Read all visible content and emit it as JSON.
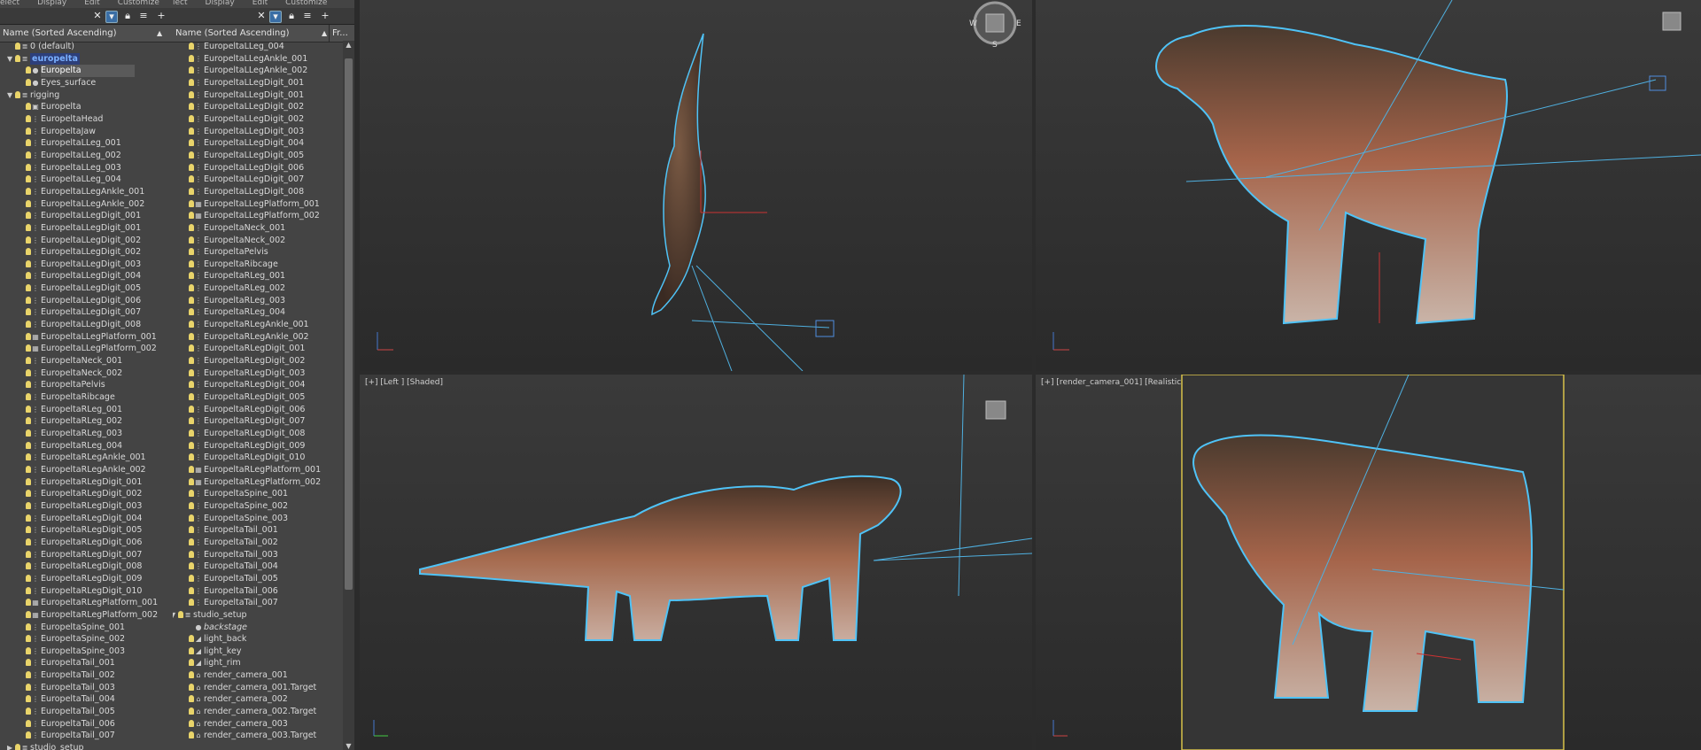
{
  "panel1": {
    "menu": [
      "elect",
      "Display",
      "Edit",
      "Customize"
    ],
    "col_name": "Name (Sorted Ascending)",
    "rows": [
      {
        "label": "0 (default)",
        "indent": 34,
        "bulb": true,
        "icon": "layer-icon"
      },
      {
        "label": "europelta",
        "indent": 34,
        "bulb": true,
        "icon": "layer-icon",
        "tri": "▼",
        "hi": true
      },
      {
        "label": "Europelta",
        "indent": 46,
        "bulb": true,
        "icon": "sphere-icon",
        "sel": true
      },
      {
        "label": "Eyes_surface",
        "indent": 46,
        "bulb": true,
        "icon": "sphere-icon"
      },
      {
        "label": "rigging",
        "indent": 34,
        "bulb": true,
        "icon": "layer-icon",
        "tri": "▼"
      },
      {
        "label": "Europelta",
        "indent": 46,
        "bulb": true,
        "icon": "group-icon"
      },
      {
        "label": "EuropeltaHead",
        "indent": 46,
        "bulb": true,
        "icon": "bone-icon"
      },
      {
        "label": "EuropeltaJaw",
        "indent": 46,
        "bulb": true,
        "icon": "bone-icon"
      },
      {
        "label": "EuropeltaLLeg_001",
        "indent": 46,
        "bulb": true,
        "icon": "bone-icon"
      },
      {
        "label": "EuropeltaLLeg_002",
        "indent": 46,
        "bulb": true,
        "icon": "bone-icon"
      },
      {
        "label": "EuropeltaLLeg_003",
        "indent": 46,
        "bulb": true,
        "icon": "bone-icon"
      },
      {
        "label": "EuropeltaLLeg_004",
        "indent": 46,
        "bulb": true,
        "icon": "bone-icon"
      },
      {
        "label": "EuropeltaLLegAnkle_001",
        "indent": 46,
        "bulb": true,
        "icon": "bone-icon"
      },
      {
        "label": "EuropeltaLLegAnkle_002",
        "indent": 46,
        "bulb": true,
        "icon": "bone-icon"
      },
      {
        "label": "EuropeltaLLegDigit_001",
        "indent": 46,
        "bulb": true,
        "icon": "bone-icon"
      },
      {
        "label": "EuropeltaLLegDigit_001",
        "indent": 46,
        "bulb": true,
        "icon": "bone-icon"
      },
      {
        "label": "EuropeltaLLegDigit_002",
        "indent": 46,
        "bulb": true,
        "icon": "bone-icon"
      },
      {
        "label": "EuropeltaLLegDigit_002",
        "indent": 46,
        "bulb": true,
        "icon": "bone-icon"
      },
      {
        "label": "EuropeltaLLegDigit_003",
        "indent": 46,
        "bulb": true,
        "icon": "bone-icon"
      },
      {
        "label": "EuropeltaLLegDigit_004",
        "indent": 46,
        "bulb": true,
        "icon": "bone-icon"
      },
      {
        "label": "EuropeltaLLegDigit_005",
        "indent": 46,
        "bulb": true,
        "icon": "bone-icon"
      },
      {
        "label": "EuropeltaLLegDigit_006",
        "indent": 46,
        "bulb": true,
        "icon": "bone-icon"
      },
      {
        "label": "EuropeltaLLegDigit_007",
        "indent": 46,
        "bulb": true,
        "icon": "bone-icon"
      },
      {
        "label": "EuropeltaLLegDigit_008",
        "indent": 46,
        "bulb": true,
        "icon": "bone-icon"
      },
      {
        "label": "EuropeltaLLegPlatform_001",
        "indent": 46,
        "bulb": true,
        "icon": "platform-icon"
      },
      {
        "label": "EuropeltaLLegPlatform_002",
        "indent": 46,
        "bulb": true,
        "icon": "platform-icon"
      },
      {
        "label": "EuropeltaNeck_001",
        "indent": 46,
        "bulb": true,
        "icon": "bone-icon"
      },
      {
        "label": "EuropeltaNeck_002",
        "indent": 46,
        "bulb": true,
        "icon": "bone-icon"
      },
      {
        "label": "EuropeltaPelvis",
        "indent": 46,
        "bulb": true,
        "icon": "bone-icon"
      },
      {
        "label": "EuropeltaRibcage",
        "indent": 46,
        "bulb": true,
        "icon": "bone-icon"
      },
      {
        "label": "EuropeltaRLeg_001",
        "indent": 46,
        "bulb": true,
        "icon": "bone-icon"
      },
      {
        "label": "EuropeltaRLeg_002",
        "indent": 46,
        "bulb": true,
        "icon": "bone-icon"
      },
      {
        "label": "EuropeltaRLeg_003",
        "indent": 46,
        "bulb": true,
        "icon": "bone-icon"
      },
      {
        "label": "EuropeltaRLeg_004",
        "indent": 46,
        "bulb": true,
        "icon": "bone-icon"
      },
      {
        "label": "EuropeltaRLegAnkle_001",
        "indent": 46,
        "bulb": true,
        "icon": "bone-icon"
      },
      {
        "label": "EuropeltaRLegAnkle_002",
        "indent": 46,
        "bulb": true,
        "icon": "bone-icon"
      },
      {
        "label": "EuropeltaRLegDigit_001",
        "indent": 46,
        "bulb": true,
        "icon": "bone-icon"
      },
      {
        "label": "EuropeltaRLegDigit_002",
        "indent": 46,
        "bulb": true,
        "icon": "bone-icon"
      },
      {
        "label": "EuropeltaRLegDigit_003",
        "indent": 46,
        "bulb": true,
        "icon": "bone-icon"
      },
      {
        "label": "EuropeltaRLegDigit_004",
        "indent": 46,
        "bulb": true,
        "icon": "bone-icon"
      },
      {
        "label": "EuropeltaRLegDigit_005",
        "indent": 46,
        "bulb": true,
        "icon": "bone-icon"
      },
      {
        "label": "EuropeltaRLegDigit_006",
        "indent": 46,
        "bulb": true,
        "icon": "bone-icon"
      },
      {
        "label": "EuropeltaRLegDigit_007",
        "indent": 46,
        "bulb": true,
        "icon": "bone-icon"
      },
      {
        "label": "EuropeltaRLegDigit_008",
        "indent": 46,
        "bulb": true,
        "icon": "bone-icon"
      },
      {
        "label": "EuropeltaRLegDigit_009",
        "indent": 46,
        "bulb": true,
        "icon": "bone-icon"
      },
      {
        "label": "EuropeltaRLegDigit_010",
        "indent": 46,
        "bulb": true,
        "icon": "bone-icon"
      },
      {
        "label": "EuropeltaRLegPlatform_001",
        "indent": 46,
        "bulb": true,
        "icon": "platform-icon"
      },
      {
        "label": "EuropeltaRLegPlatform_002",
        "indent": 46,
        "bulb": true,
        "icon": "platform-icon"
      },
      {
        "label": "EuropeltaSpine_001",
        "indent": 46,
        "bulb": true,
        "icon": "bone-icon"
      },
      {
        "label": "EuropeltaSpine_002",
        "indent": 46,
        "bulb": true,
        "icon": "bone-icon"
      },
      {
        "label": "EuropeltaSpine_003",
        "indent": 46,
        "bulb": true,
        "icon": "bone-icon"
      },
      {
        "label": "EuropeltaTail_001",
        "indent": 46,
        "bulb": true,
        "icon": "bone-icon"
      },
      {
        "label": "EuropeltaTail_002",
        "indent": 46,
        "bulb": true,
        "icon": "bone-icon"
      },
      {
        "label": "EuropeltaTail_003",
        "indent": 46,
        "bulb": true,
        "icon": "bone-icon"
      },
      {
        "label": "EuropeltaTail_004",
        "indent": 46,
        "bulb": true,
        "icon": "bone-icon"
      },
      {
        "label": "EuropeltaTail_005",
        "indent": 46,
        "bulb": true,
        "icon": "bone-icon"
      },
      {
        "label": "EuropeltaTail_006",
        "indent": 46,
        "bulb": true,
        "icon": "bone-icon"
      },
      {
        "label": "EuropeltaTail_007",
        "indent": 46,
        "bulb": true,
        "icon": "bone-icon"
      },
      {
        "label": "studio_setup",
        "indent": 34,
        "bulb": true,
        "icon": "layer-icon",
        "tri": "▶"
      }
    ]
  },
  "panel2": {
    "menu": [
      "lect",
      "Display",
      "Edit",
      "Customize"
    ],
    "col_name": "Name (Sorted Ascending)",
    "col_fr": "Fr...",
    "rows": [
      {
        "label": "EuropeltaLLeg_004",
        "indent": 35,
        "bulb": true,
        "icon": "bone-icon"
      },
      {
        "label": "EuropeltaLLegAnkle_001",
        "indent": 35,
        "bulb": true,
        "icon": "bone-icon"
      },
      {
        "label": "EuropeltaLLegAnkle_002",
        "indent": 35,
        "bulb": true,
        "icon": "bone-icon"
      },
      {
        "label": "EuropeltaLLegDigit_001",
        "indent": 35,
        "bulb": true,
        "icon": "bone-icon"
      },
      {
        "label": "EuropeltaLLegDigit_001",
        "indent": 35,
        "bulb": true,
        "icon": "bone-icon"
      },
      {
        "label": "EuropeltaLLegDigit_002",
        "indent": 35,
        "bulb": true,
        "icon": "bone-icon"
      },
      {
        "label": "EuropeltaLLegDigit_002",
        "indent": 35,
        "bulb": true,
        "icon": "bone-icon"
      },
      {
        "label": "EuropeltaLLegDigit_003",
        "indent": 35,
        "bulb": true,
        "icon": "bone-icon"
      },
      {
        "label": "EuropeltaLLegDigit_004",
        "indent": 35,
        "bulb": true,
        "icon": "bone-icon"
      },
      {
        "label": "EuropeltaLLegDigit_005",
        "indent": 35,
        "bulb": true,
        "icon": "bone-icon"
      },
      {
        "label": "EuropeltaLLegDigit_006",
        "indent": 35,
        "bulb": true,
        "icon": "bone-icon"
      },
      {
        "label": "EuropeltaLLegDigit_007",
        "indent": 35,
        "bulb": true,
        "icon": "bone-icon"
      },
      {
        "label": "EuropeltaLLegDigit_008",
        "indent": 35,
        "bulb": true,
        "icon": "bone-icon"
      },
      {
        "label": "EuropeltaLLegPlatform_001",
        "indent": 35,
        "bulb": true,
        "icon": "platform-icon"
      },
      {
        "label": "EuropeltaLLegPlatform_002",
        "indent": 35,
        "bulb": true,
        "icon": "platform-icon"
      },
      {
        "label": "EuropeltaNeck_001",
        "indent": 35,
        "bulb": true,
        "icon": "bone-icon"
      },
      {
        "label": "EuropeltaNeck_002",
        "indent": 35,
        "bulb": true,
        "icon": "bone-icon"
      },
      {
        "label": "EuropeltaPelvis",
        "indent": 35,
        "bulb": true,
        "icon": "bone-icon"
      },
      {
        "label": "EuropeltaRibcage",
        "indent": 35,
        "bulb": true,
        "icon": "bone-icon"
      },
      {
        "label": "EuropeltaRLeg_001",
        "indent": 35,
        "bulb": true,
        "icon": "bone-icon"
      },
      {
        "label": "EuropeltaRLeg_002",
        "indent": 35,
        "bulb": true,
        "icon": "bone-icon"
      },
      {
        "label": "EuropeltaRLeg_003",
        "indent": 35,
        "bulb": true,
        "icon": "bone-icon"
      },
      {
        "label": "EuropeltaRLeg_004",
        "indent": 35,
        "bulb": true,
        "icon": "bone-icon"
      },
      {
        "label": "EuropeltaRLegAnkle_001",
        "indent": 35,
        "bulb": true,
        "icon": "bone-icon"
      },
      {
        "label": "EuropeltaRLegAnkle_002",
        "indent": 35,
        "bulb": true,
        "icon": "bone-icon"
      },
      {
        "label": "EuropeltaRLegDigit_001",
        "indent": 35,
        "bulb": true,
        "icon": "bone-icon"
      },
      {
        "label": "EuropeltaRLegDigit_002",
        "indent": 35,
        "bulb": true,
        "icon": "bone-icon"
      },
      {
        "label": "EuropeltaRLegDigit_003",
        "indent": 35,
        "bulb": true,
        "icon": "bone-icon"
      },
      {
        "label": "EuropeltaRLegDigit_004",
        "indent": 35,
        "bulb": true,
        "icon": "bone-icon"
      },
      {
        "label": "EuropeltaRLegDigit_005",
        "indent": 35,
        "bulb": true,
        "icon": "bone-icon"
      },
      {
        "label": "EuropeltaRLegDigit_006",
        "indent": 35,
        "bulb": true,
        "icon": "bone-icon"
      },
      {
        "label": "EuropeltaRLegDigit_007",
        "indent": 35,
        "bulb": true,
        "icon": "bone-icon"
      },
      {
        "label": "EuropeltaRLegDigit_008",
        "indent": 35,
        "bulb": true,
        "icon": "bone-icon"
      },
      {
        "label": "EuropeltaRLegDigit_009",
        "indent": 35,
        "bulb": true,
        "icon": "bone-icon"
      },
      {
        "label": "EuropeltaRLegDigit_010",
        "indent": 35,
        "bulb": true,
        "icon": "bone-icon"
      },
      {
        "label": "EuropeltaRLegPlatform_001",
        "indent": 35,
        "bulb": true,
        "icon": "platform-icon"
      },
      {
        "label": "EuropeltaRLegPlatform_002",
        "indent": 35,
        "bulb": true,
        "icon": "platform-icon"
      },
      {
        "label": "EuropeltaSpine_001",
        "indent": 35,
        "bulb": true,
        "icon": "bone-icon"
      },
      {
        "label": "EuropeltaSpine_002",
        "indent": 35,
        "bulb": true,
        "icon": "bone-icon"
      },
      {
        "label": "EuropeltaSpine_003",
        "indent": 35,
        "bulb": true,
        "icon": "bone-icon"
      },
      {
        "label": "EuropeltaTail_001",
        "indent": 35,
        "bulb": true,
        "icon": "bone-icon"
      },
      {
        "label": "EuropeltaTail_002",
        "indent": 35,
        "bulb": true,
        "icon": "bone-icon"
      },
      {
        "label": "EuropeltaTail_003",
        "indent": 35,
        "bulb": true,
        "icon": "bone-icon"
      },
      {
        "label": "EuropeltaTail_004",
        "indent": 35,
        "bulb": true,
        "icon": "bone-icon"
      },
      {
        "label": "EuropeltaTail_005",
        "indent": 35,
        "bulb": true,
        "icon": "bone-icon"
      },
      {
        "label": "EuropeltaTail_006",
        "indent": 35,
        "bulb": true,
        "icon": "bone-icon"
      },
      {
        "label": "EuropeltaTail_007",
        "indent": 35,
        "bulb": true,
        "icon": "bone-icon"
      },
      {
        "label": "studio_setup",
        "indent": 23,
        "bulb": true,
        "icon": "layer-icon",
        "tri": "▼"
      },
      {
        "label": "backstage",
        "indent": 35,
        "bulb": false,
        "icon": "sphere-icon",
        "ital": true
      },
      {
        "label": "light_back",
        "indent": 35,
        "bulb": true,
        "icon": "light-icon"
      },
      {
        "label": "light_key",
        "indent": 35,
        "bulb": true,
        "icon": "light-icon"
      },
      {
        "label": "light_rim",
        "indent": 35,
        "bulb": true,
        "icon": "light-icon"
      },
      {
        "label": "render_camera_001",
        "indent": 35,
        "bulb": true,
        "icon": "camera-icon"
      },
      {
        "label": "render_camera_001.Target",
        "indent": 35,
        "bulb": true,
        "icon": "camera-icon"
      },
      {
        "label": "render_camera_002",
        "indent": 35,
        "bulb": true,
        "icon": "camera-icon"
      },
      {
        "label": "render_camera_002.Target",
        "indent": 35,
        "bulb": true,
        "icon": "camera-icon"
      },
      {
        "label": "render_camera_003",
        "indent": 35,
        "bulb": true,
        "icon": "camera-icon"
      },
      {
        "label": "render_camera_003.Target",
        "indent": 35,
        "bulb": true,
        "icon": "camera-icon"
      }
    ]
  },
  "viewports": {
    "top_left_label": "",
    "top_right_label": "",
    "bottom_left_label": "[+] [Left ] [Shaded]",
    "bottom_right_label": "[+] [render_camera_001] [Realistic]",
    "viewcube_letters": [
      "W",
      "E",
      "S"
    ]
  },
  "colors": {
    "selection_outline": "#4fc3f7",
    "active_viewport": "#d8c24a",
    "skin": "#a86e52"
  }
}
